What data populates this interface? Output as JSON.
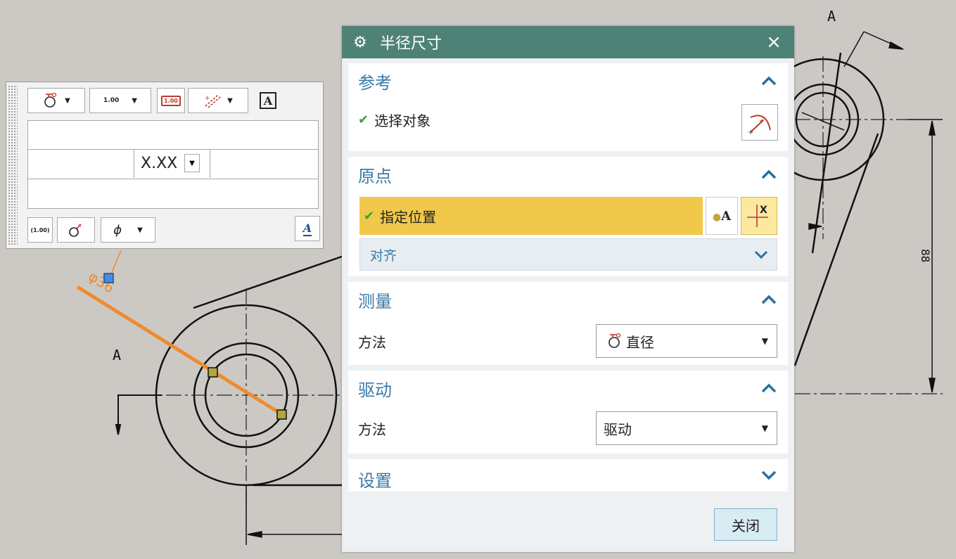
{
  "drawing": {
    "label_a_left": "A",
    "label_a_top": "A",
    "dim_88": "88"
  },
  "toolbar": {
    "precision_value": "1.00",
    "format_label": "X.XX",
    "phi_symbol": "ϕ"
  },
  "dialog": {
    "title": "半径尺寸",
    "close_glyph": "×",
    "reference": {
      "title": "参考",
      "select_object": "选择对象"
    },
    "origin": {
      "title": "原点",
      "specify_location": "指定位置",
      "align": "对齐"
    },
    "measure": {
      "title": "测量",
      "method_label": "方法",
      "method_value": "直径"
    },
    "drive": {
      "title": "驱动",
      "method_label": "方法",
      "method_value": "驱动"
    },
    "settings": {
      "title": "设置"
    },
    "close_button": "关闭"
  },
  "colors": {
    "title_bar": "#4f8277",
    "section_title": "#3a7aa8",
    "highlight": "#f0c84a",
    "highlight_light": "#fbe9a0",
    "selection_orange": "#ef8b2d",
    "check_green": "#36a33a",
    "chevron_blue": "#2d6f9e"
  }
}
